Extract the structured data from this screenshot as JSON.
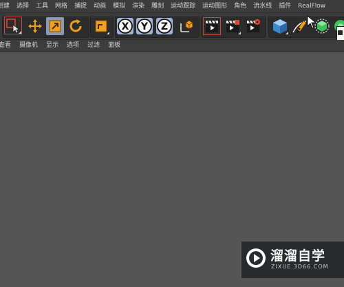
{
  "menu": {
    "items": [
      "创建",
      "选择",
      "工具",
      "网格",
      "捕捉",
      "动画",
      "模拟",
      "渲染",
      "雕刻",
      "运动跟踪",
      "运动图形",
      "角色",
      "流水线",
      "插件",
      "RealFlow"
    ]
  },
  "toolbar": {
    "groups": [
      {
        "name": "transform-tools",
        "buttons": [
          "live-selection-icon",
          "move-icon",
          "scale-icon",
          "rotate-icon"
        ]
      },
      {
        "name": "recent-tool",
        "buttons": [
          "recent-object-icon"
        ]
      },
      {
        "name": "axis-lock",
        "buttons": [
          "x-axis-icon",
          "y-axis-icon",
          "z-axis-icon",
          "coordinate-system-icon"
        ]
      },
      {
        "name": "render",
        "buttons": [
          "render-view-icon",
          "render-picture-viewer-icon",
          "render-settings-icon"
        ]
      },
      {
        "name": "objects",
        "buttons": [
          "cube-icon",
          "pen-icon",
          "subdivision-icon",
          "array-icon"
        ]
      }
    ],
    "axis_labels": {
      "x": "X",
      "y": "Y",
      "z": "Z"
    }
  },
  "submenu": {
    "items": [
      "查看",
      "摄像机",
      "显示",
      "选项",
      "过滤",
      "面板"
    ]
  },
  "watermark": {
    "title": "溜溜自学",
    "url": "ZIXUE.3D66.COM"
  },
  "colors": {
    "viewport_bg": "#555555",
    "menubar_bg": "#3c3c3c",
    "active_button": "#8a9ab5",
    "accent_orange": "#f0a020",
    "axis_blue": "#9fb4d6"
  }
}
